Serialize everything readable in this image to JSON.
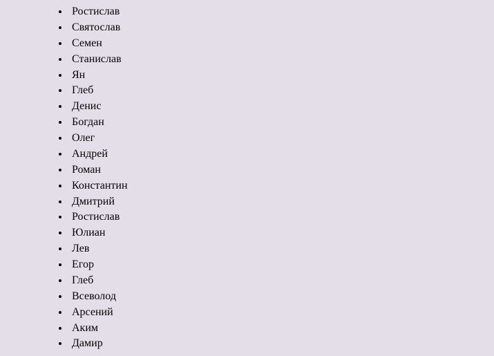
{
  "names": [
    "Ростислав",
    "Святослав",
    "Семен",
    "Станислав",
    "Ян",
    "Глеб",
    "Денис",
    "Богдан",
    "Олег",
    "Андрей",
    "Роман",
    "Константин",
    "Дмитрий",
    "Ростислав",
    "Юлиан",
    "Лев",
    "Егор",
    "Глеб",
    "Всеволод",
    "Арсений",
    "Аким",
    "Дамир"
  ]
}
